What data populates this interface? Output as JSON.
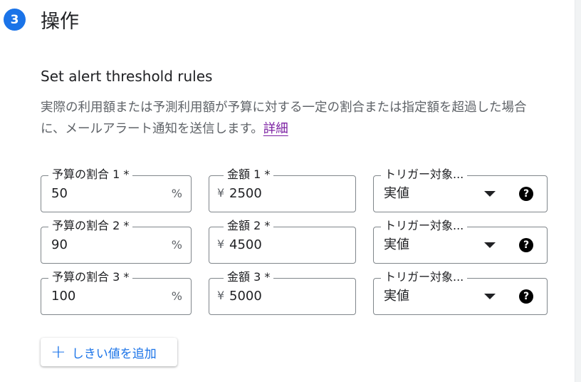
{
  "step": {
    "number": "3",
    "title": "操作"
  },
  "section": {
    "title": "Set alert threshold rules",
    "description_line1": "実際の利用額または予測利用額が予算に対する一定の割合または指定額を超過した場合",
    "description_line2": "に、メールアラート通知を送信します。",
    "details_link": "詳細"
  },
  "rules": [
    {
      "percent_label": "予算の割合 1 *",
      "percent_value": "50",
      "percent_suffix": "%",
      "amount_label": "金額 1 *",
      "currency": "¥",
      "amount_value": "2500",
      "trigger_label": "トリガー対象...",
      "trigger_value": "実値",
      "help_glyph": "?"
    },
    {
      "percent_label": "予算の割合 2 *",
      "percent_value": "90",
      "percent_suffix": "%",
      "amount_label": "金額 2 *",
      "currency": "¥",
      "amount_value": "4500",
      "trigger_label": "トリガー対象...",
      "trigger_value": "実値",
      "help_glyph": "?"
    },
    {
      "percent_label": "予算の割合 3 *",
      "percent_value": "100",
      "percent_suffix": "%",
      "amount_label": "金額 3 *",
      "currency": "¥",
      "amount_value": "5000",
      "trigger_label": "トリガー対象...",
      "trigger_value": "実値",
      "help_glyph": "?"
    }
  ],
  "add_button": {
    "icon": "plus-icon",
    "label": "しきい値を追加"
  },
  "colors": {
    "accent": "#1a73e8",
    "link_visited": "#7b1fa2",
    "text": "#202124",
    "muted": "#5f6368",
    "border": "#80868b"
  }
}
